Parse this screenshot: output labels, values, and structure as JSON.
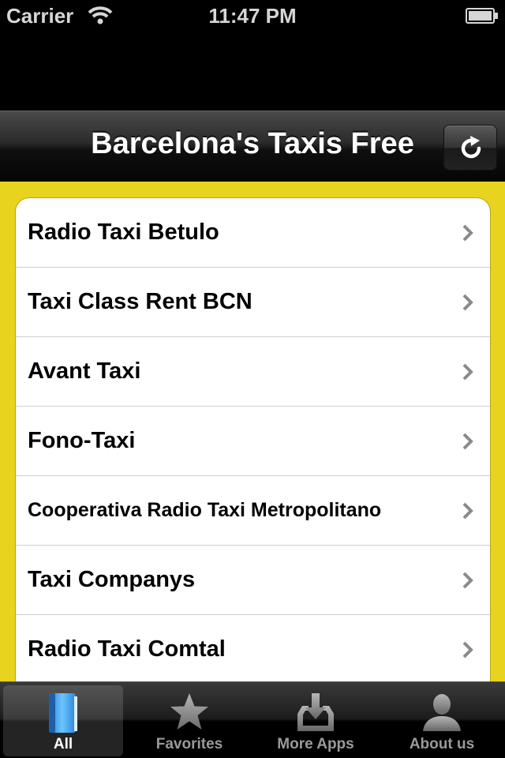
{
  "status_bar": {
    "carrier": "Carrier",
    "time": "11:47 PM"
  },
  "nav_bar": {
    "title": "Barcelona's Taxis Free",
    "refresh_icon": "refresh-icon"
  },
  "list": {
    "items": [
      {
        "label": "Radio Taxi Betulo"
      },
      {
        "label": "Taxi Class Rent BCN"
      },
      {
        "label": "Avant Taxi"
      },
      {
        "label": "Fono-Taxi"
      },
      {
        "label": "Cooperativa Radio Taxi Metropolitano"
      },
      {
        "label": "Taxi Companys"
      },
      {
        "label": "Radio Taxi Comtal"
      }
    ]
  },
  "tab_bar": {
    "tabs": [
      {
        "label": "All",
        "icon": "book-icon",
        "selected": true
      },
      {
        "label": "Favorites",
        "icon": "star-icon",
        "selected": false
      },
      {
        "label": "More Apps",
        "icon": "download-tray-icon",
        "selected": false
      },
      {
        "label": "About us",
        "icon": "person-icon",
        "selected": false
      }
    ]
  },
  "colors": {
    "background_yellow": "#e8d31e",
    "nav_dark": "#1a1a1a"
  }
}
